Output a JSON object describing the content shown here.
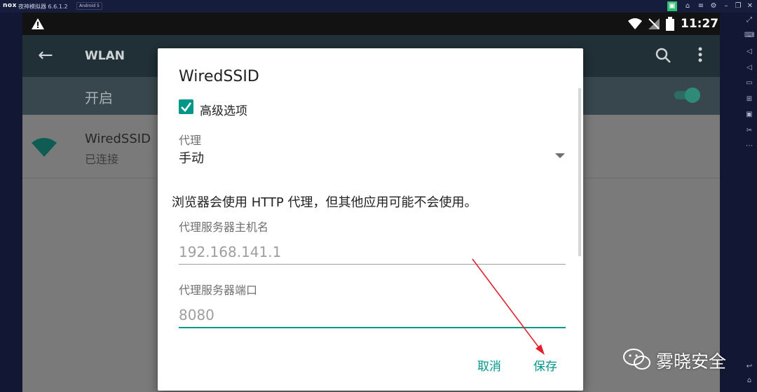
{
  "emulator": {
    "logo": "nox",
    "title": "夜神模拟器 6.6.1.2",
    "android_badge": "Android 5"
  },
  "status_bar": {
    "time": "11:27"
  },
  "app_bar": {
    "title": "WLAN"
  },
  "switch_row": {
    "label": "开启"
  },
  "network": {
    "ssid": "WiredSSID",
    "status": "已连接"
  },
  "dialog": {
    "title": "WiredSSID",
    "advanced_label": "高级选项",
    "proxy_label": "代理",
    "proxy_value": "手动",
    "info_text": "浏览器会使用 HTTP 代理，但其他应用可能不会使用。",
    "host_label": "代理服务器主机名",
    "host_value": "192.168.141.1",
    "port_label": "代理服务器端口",
    "port_value": "8080",
    "cancel_label": "取消",
    "save_label": "保存"
  },
  "watermark": {
    "text": "雾晓安全"
  },
  "colors": {
    "accent": "#009688",
    "annotation_arrow": "#e0202a"
  }
}
